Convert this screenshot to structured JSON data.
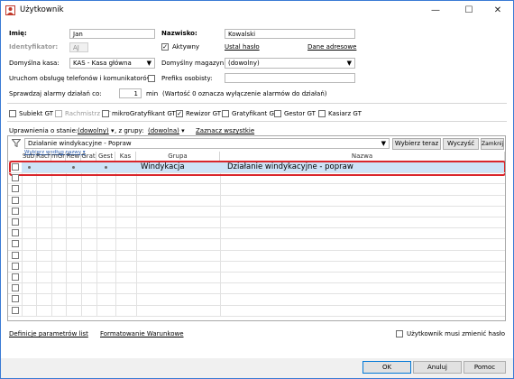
{
  "window": {
    "title": "Użytkownik",
    "minimize": "—",
    "maximize": "☐",
    "close": "✕"
  },
  "form": {
    "imie_label": "Imię:",
    "imie_value": "Jan",
    "nazwisko_label": "Nazwisko:",
    "nazwisko_value": "Kowalski",
    "identyfikator_label": "Identyfikator:",
    "identyfikator_value": "AJ",
    "aktywny_label": "Aktywny",
    "aktywny_checked": true,
    "ustal_haslo": "Ustal hasło",
    "dane_adresowe": "Dane adresowe",
    "kasa_label": "Domyślna kasa:",
    "kasa_value": "KAS - Kasa główna",
    "magazyn_label": "Domyślny magazyn:",
    "magazyn_value": "(dowolny)",
    "uruchom_label": "Uruchom obsługę telefonów i komunikatorów",
    "prefiks_label": "Prefiks osobisty:",
    "prefiks_value": "",
    "alarmy_label": "Sprawdzaj alarmy działań co:",
    "alarmy_value": "1",
    "alarmy_unit": "min",
    "alarmy_note": "(Wartość 0 oznacza wyłączenie alarmów do działań)"
  },
  "roles": [
    {
      "label": "Subiekt GT",
      "checked": false,
      "disabled": false
    },
    {
      "label": "Rachmistrz GT",
      "checked": false,
      "disabled": true
    },
    {
      "label": "mikroGratyfikant GT",
      "checked": false,
      "disabled": false
    },
    {
      "label": "Rewizor GT",
      "checked": true,
      "disabled": false
    },
    {
      "label": "Gratyfikant GT",
      "checked": false,
      "disabled": false
    },
    {
      "label": "Gestor GT",
      "checked": false,
      "disabled": false
    },
    {
      "label": "Kasiarz GT",
      "checked": false,
      "disabled": false
    }
  ],
  "filter": {
    "stan_label": "Uprawnienia o stanie:",
    "stan_value": "(dowolny)",
    "grupa_label": ", z grupy:",
    "grupa_value": "(dowolna)",
    "zaznacz_wszystkie": "Zaznacz wszystkie",
    "search_value": "Działanie windykacyjne - Popraw",
    "wybierz_teraz": "Wybierz teraz",
    "wyczysc": "Wyczyść",
    "zamknij": "Zamknij",
    "wybierz_wedlug": "Wybierz według nazwy"
  },
  "grid": {
    "columns": [
      "Sub",
      "Rach",
      "mGr",
      "Rew",
      "Grat",
      "Gest",
      "Kas",
      "Grupa",
      "Nazwa"
    ],
    "rows": [
      {
        "checked": false,
        "sub": true,
        "rach": false,
        "mgr": false,
        "rew": true,
        "grat": false,
        "gest": true,
        "kas": false,
        "grupa": "Windykacja",
        "nazwa": "Działanie windykacyjne - popraw"
      }
    ]
  },
  "footer": {
    "definicje": "Definicje parametrów list",
    "formatowanie": "Formatowanie Warunkowe",
    "musi_zmienic": "Użytkownik musi zmienić hasło"
  },
  "buttons": {
    "ok": "OK",
    "anuluj": "Anuluj",
    "pomoc": "Pomoc"
  },
  "colors": {
    "highlight_row": "#cde3f7",
    "highlight_border": "#d9262b",
    "accent": "#0078d7"
  }
}
